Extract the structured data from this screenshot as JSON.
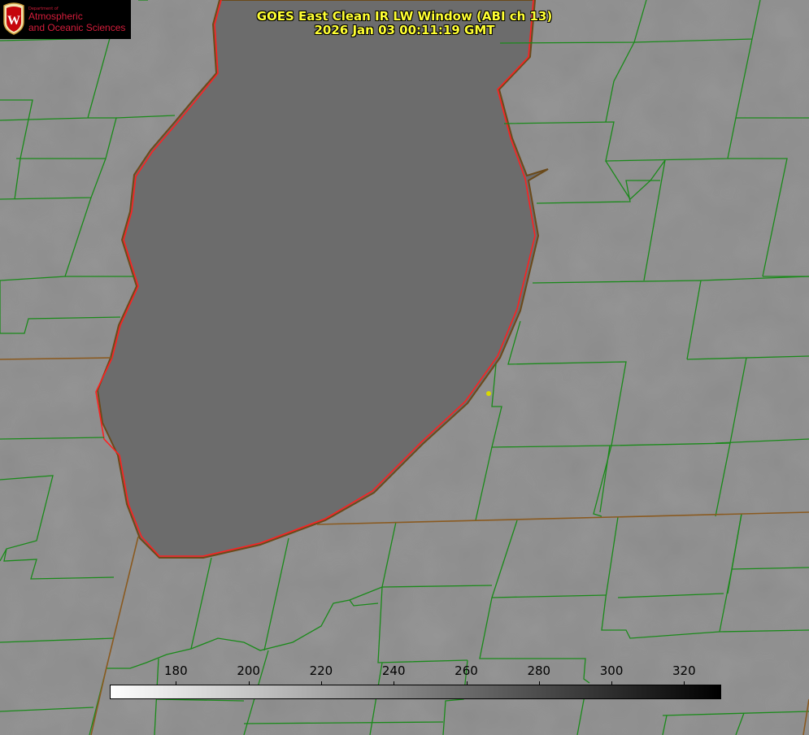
{
  "title": {
    "line1": "GOES East Clean IR LW Window (ABI ch 13)",
    "line2": "2026 Jan 03 00:11:19 GMT"
  },
  "logo": {
    "dept": "Department of",
    "line1": "Atmospheric",
    "line2": "and Oceanic Sciences",
    "emblem": "W"
  },
  "colorbar": {
    "min": 162,
    "max": 330,
    "ticks": [
      "180",
      "200",
      "220",
      "240",
      "260",
      "280",
      "300",
      "320"
    ]
  },
  "colors": {
    "title": "#ffff33",
    "county_lines": "#1a8a1a",
    "coastline": "#ff2020",
    "logo": "#d41d3b"
  }
}
